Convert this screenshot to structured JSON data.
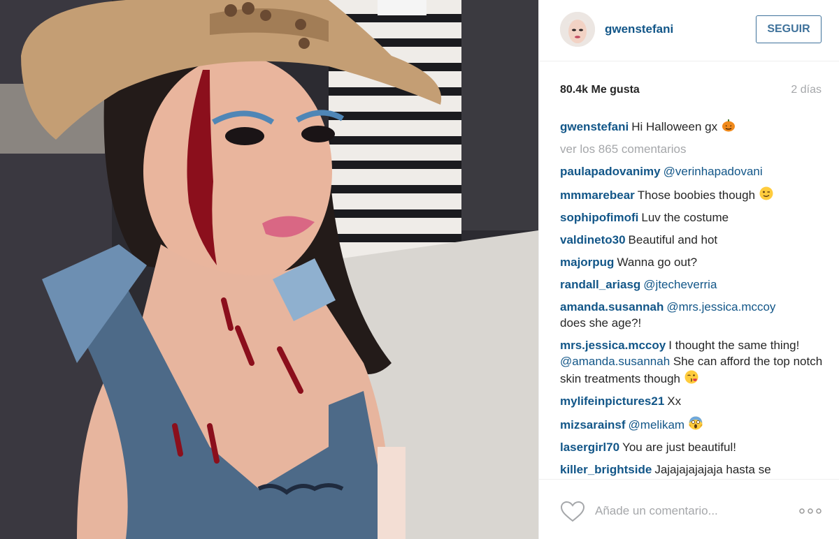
{
  "post": {
    "username": "gwenstefani",
    "follow_label": "SEGUIR",
    "likes": "80.4k Me gusta",
    "time_ago": "2 días",
    "caption": {
      "user": "gwenstefani",
      "text": "Hi Halloween gx",
      "emoji": "pumpkin-emoji"
    },
    "view_all_comments": "ver los 865 comentarios"
  },
  "comments": [
    {
      "user": "paulapadovanimy",
      "mention": "@verinhapadovani",
      "text": ""
    },
    {
      "user": "mmmarebear",
      "text": "Those boobies though",
      "emoji": "wink-emoji"
    },
    {
      "user": "sophipofimofi",
      "text": "Luv the costume"
    },
    {
      "user": "valdineto30",
      "text": "Beautiful and hot"
    },
    {
      "user": "majorpug",
      "text": "Wanna go out?"
    },
    {
      "user": "randall_ariasg",
      "mention": "@jtecheverria",
      "text": ""
    },
    {
      "user": "amanda.susannah",
      "mention": "@mrs.jessica.mccoy",
      "text": "does she age?!"
    },
    {
      "user": "mrs.jessica.mccoy",
      "text_before": "I thought the same thing!",
      "mention": "@amanda.susannah",
      "text": "She can afford the top notch skin treatments though",
      "emoji": "kiss-emoji"
    },
    {
      "user": "mylifeinpictures21",
      "text": "Xx"
    },
    {
      "user": "mizsarainsf",
      "mention": "@melikam",
      "text": "",
      "emoji": "scream-emoji"
    },
    {
      "user": "lasergirl70",
      "text": "You are just beautiful!"
    },
    {
      "user": "killer_brightside",
      "text": "Jajajajajajaja hasta se"
    }
  ],
  "footer": {
    "add_comment_placeholder": "Añade un comentario...",
    "like_icon": "heart-outline-icon",
    "options_icon": "ellipsis-icon"
  },
  "colors": {
    "username_blue": "#125688",
    "follow_border": "#3f729b",
    "muted_gray": "#a5a7aa",
    "text_dark": "#262626"
  }
}
